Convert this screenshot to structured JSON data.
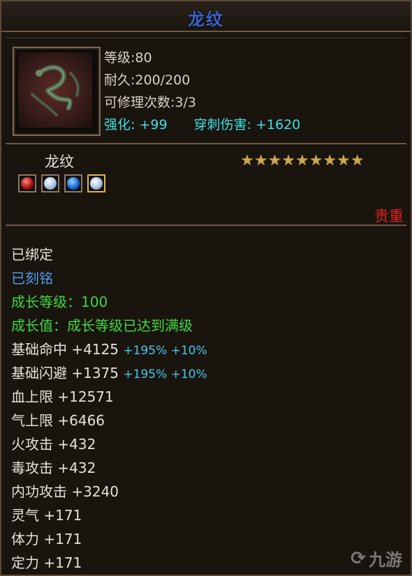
{
  "title": "龙纹",
  "header": {
    "level": "等级:80",
    "durability": "耐久:200/200",
    "repairs": "可修理次数:3/3",
    "enhance": "强化: +99",
    "pierce": "穿刺伤害: +1620"
  },
  "item": {
    "name": "龙纹",
    "stars": "★★★★★★★★★",
    "rarity": "贵重",
    "gems": [
      "red-gem",
      "white-gem",
      "blue-gem",
      "white-gem"
    ]
  },
  "details": {
    "bound": "已绑定",
    "engraved": "已刻铭",
    "growth_level": "成长等级：100",
    "growth_value": "成长值：成长等级已达到满级",
    "hit_base": "基础命中 +4125",
    "hit_extra": "+195% +10%",
    "dodge_base": "基础闪避 +1375",
    "dodge_extra": "+195% +10%",
    "hp": "血上限 +12571",
    "mp": "气上限 +6466",
    "fire": "火攻击 +432",
    "poison": "毒攻击 +432",
    "internal": "内功攻击 +3240",
    "spirit": "灵气 +171",
    "stamina": "体力 +171",
    "focus": "定力 +171"
  },
  "watermark": "九游",
  "colors": {
    "title": "#3c63c7",
    "cyan": "#3ee0e0",
    "green": "#3ed93e",
    "blue": "#4a9be8",
    "rarity": "#e0231c",
    "star": "#c9a850"
  }
}
